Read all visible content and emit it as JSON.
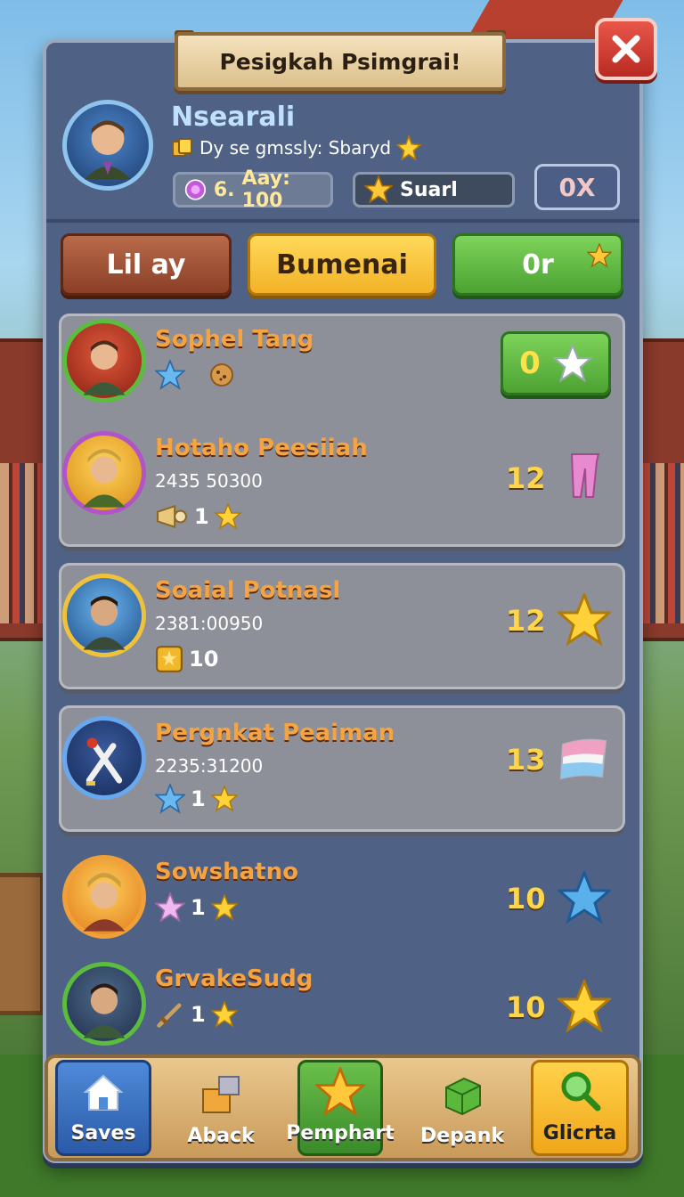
{
  "title": "Pesigkah Psimgrai!",
  "profile": {
    "name": "Nsearali",
    "subtitle": "Dy se gmssly: Sbaryd",
    "coins_prefix": "6.",
    "coins_label": "Aay: 100",
    "stars_label": "Suarl",
    "extra_button": "0X"
  },
  "tabs": [
    {
      "label": "Lil ay"
    },
    {
      "label": "Bumenai"
    },
    {
      "label": "0r"
    }
  ],
  "rows": [
    {
      "name": "Sophel Tang",
      "time": "",
      "badge_text": "",
      "score": "0",
      "claim": true
    },
    {
      "name": "Hotaho Peesiiah",
      "time": "2435 50300",
      "badge_text": "1",
      "score": "12",
      "icon": "pink-pants-icon"
    },
    {
      "name": "Soaial Potnasl",
      "time": "2381:00950",
      "badge_text": "10",
      "score": "12",
      "icon": "gold-star-icon"
    },
    {
      "name": "Pergnkat Peaiman",
      "time": "2235:31200",
      "badge_text": "1",
      "score": "13",
      "icon": "flag-icon"
    },
    {
      "name": "Sowshatno",
      "time": "",
      "badge_text": "1",
      "score": "10",
      "icon": "blue-star-icon"
    },
    {
      "name": "GrvakeSudg",
      "time": "",
      "badge_text": "1",
      "score": "10",
      "icon": "gold-star-icon"
    }
  ],
  "nav": [
    {
      "label": "Saves",
      "icon": "house-icon"
    },
    {
      "label": "Aback",
      "icon": "crate-icon"
    },
    {
      "label": "Pemphart",
      "icon": "star-icon"
    },
    {
      "label": "Depank",
      "icon": "green-block-icon"
    },
    {
      "label": "Glicrta",
      "icon": "magnifier-icon"
    }
  ],
  "colors": {
    "panel": "#4f6285",
    "accent_gold": "#ffd54a",
    "name_orange": "#f4a442",
    "close_red": "#d8402f",
    "green": "#5bbd3e"
  }
}
